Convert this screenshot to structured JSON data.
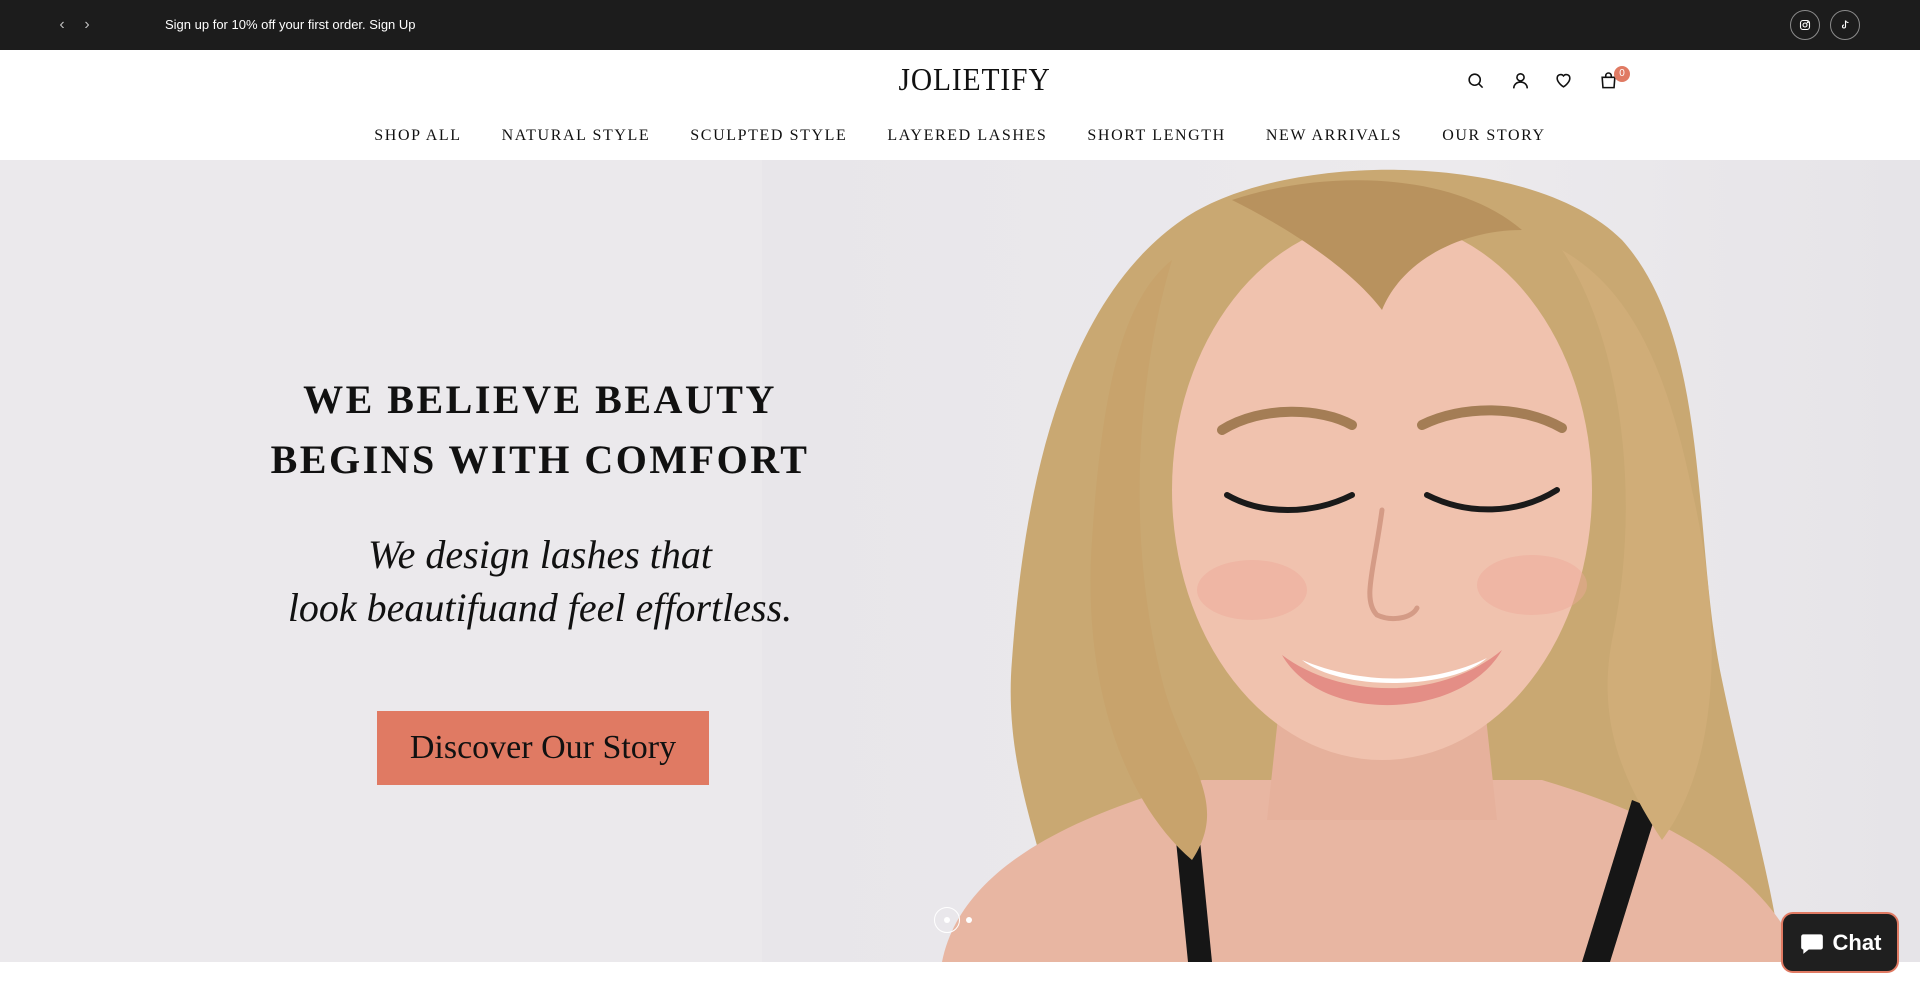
{
  "announcement": {
    "message": "Sign up for 10% off your first order. Sign Up",
    "prev_icon": "chevron-left-icon",
    "next_icon": "chevron-right-icon",
    "social": [
      "instagram-icon",
      "tiktok-icon"
    ]
  },
  "header": {
    "logo": "JOLIETIFY",
    "icons": [
      "search-icon",
      "account-icon",
      "heart-icon",
      "cart-icon"
    ],
    "cart_count": "0",
    "cart_badge_color": "#e07a63"
  },
  "nav": {
    "items": [
      {
        "label": "SHOP ALL"
      },
      {
        "label": "NATURAL STYLE"
      },
      {
        "label": "SCULPTED STYLE"
      },
      {
        "label": "LAYERED LASHES"
      },
      {
        "label": "SHORT LENGTH"
      },
      {
        "label": "NEW ARRIVALS"
      },
      {
        "label": "OUR STORY"
      }
    ]
  },
  "hero": {
    "title_line1": "WE BELIEVE BEAUTY",
    "title_line2": "BEGINS WITH COMFORT",
    "subtitle_line1": "We design lashes that",
    "subtitle_line2": "look beautifuand feel effortless.",
    "cta_label": "Discover Our Story",
    "cta_color": "#e07a63",
    "slides_total": 2,
    "slide_active": 1
  },
  "chat": {
    "label": "Chat",
    "icon": "chat-bubble-icon"
  }
}
